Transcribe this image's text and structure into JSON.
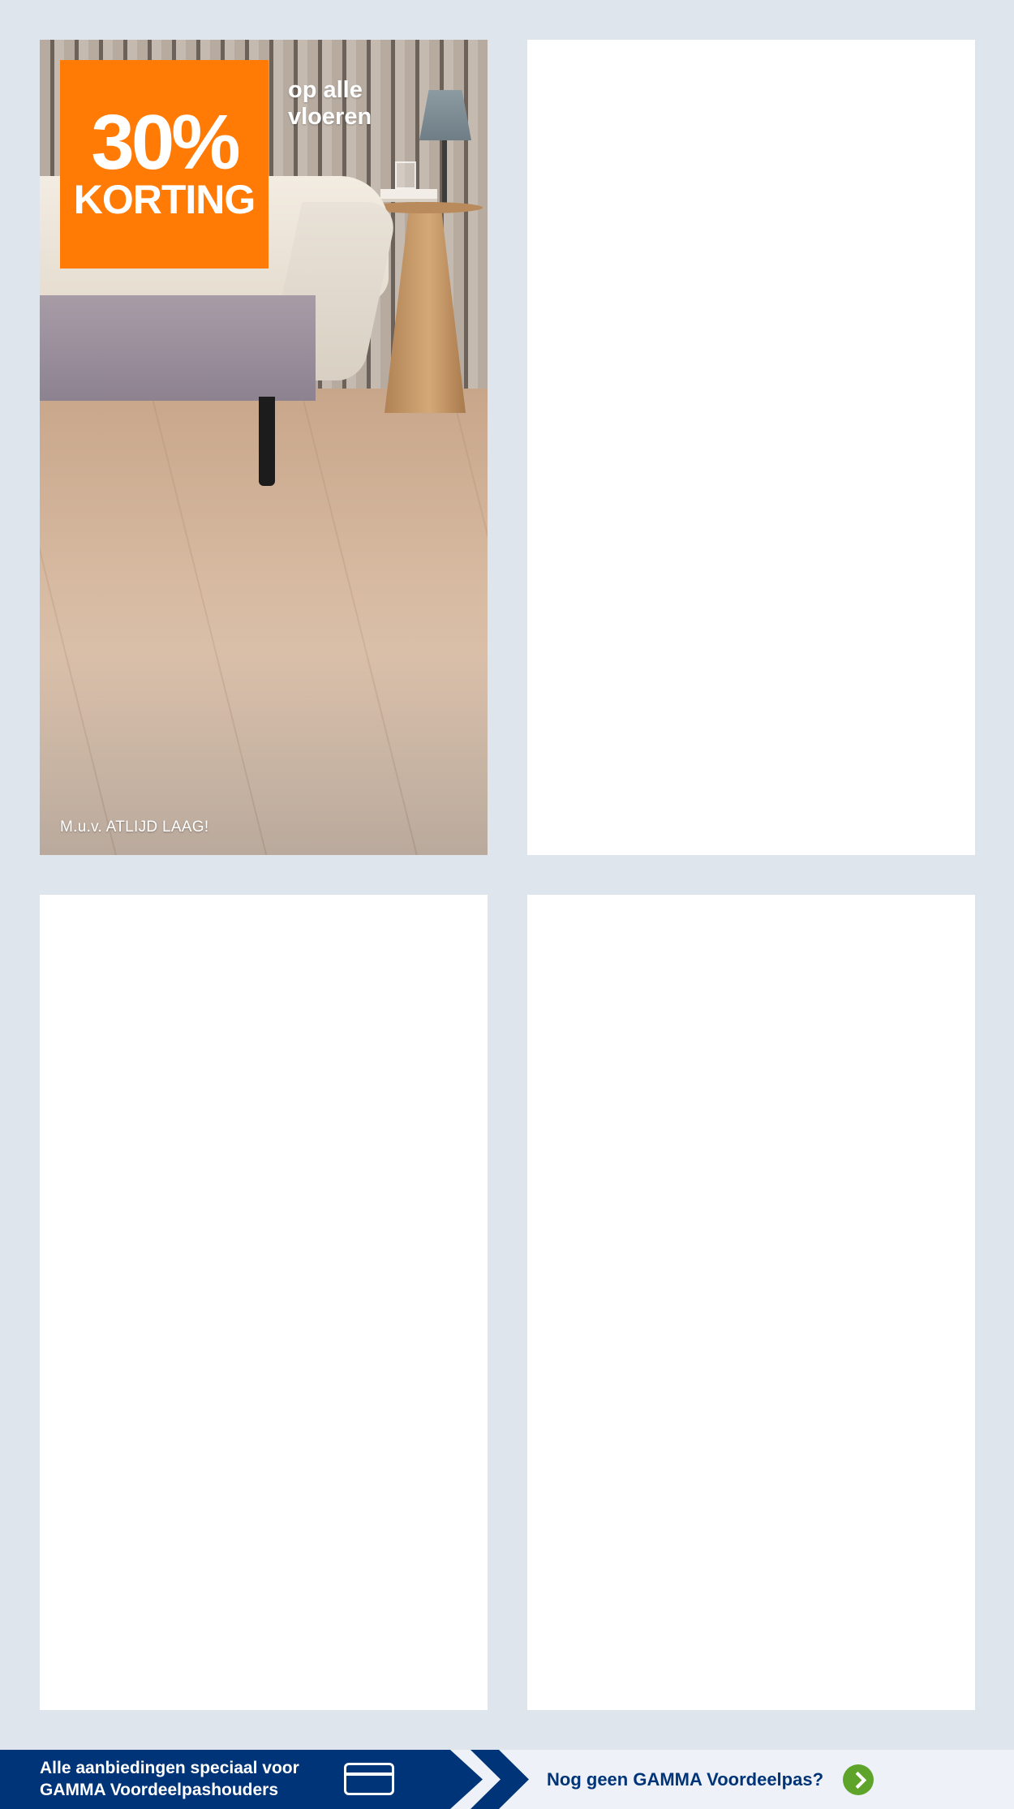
{
  "promo": {
    "badge_percent": "30%",
    "badge_label": "KORTING",
    "subhead_line1": "op alle",
    "subhead_line2": "vloeren",
    "disclaimer": "M.u.v. ATLIJD LAAG!",
    "badge_color": "#ff7b06"
  },
  "banner": {
    "left_line1": "Alle aanbiedingen speciaal voor",
    "left_line2": "GAMMA Voordeelpashouders",
    "right_text": "Nog geen GAMMA Voordeelpas?",
    "left_icon": "card-icon",
    "right_icon": "chevron-right-circle-icon",
    "brand_color": "#003478",
    "accent_color": "#5fa42a"
  }
}
